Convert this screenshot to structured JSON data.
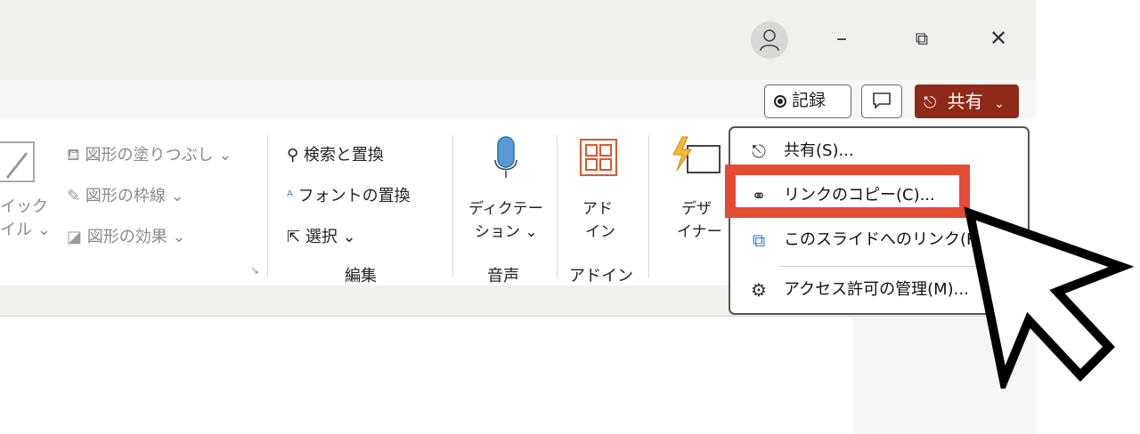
{
  "window": {
    "minimize": "–",
    "restore": "⧉",
    "close": "✕"
  },
  "toolbar": {
    "record_label": "記録",
    "comment_icon": "comment-icon",
    "share_label": "共有",
    "share_chevron": "⌄"
  },
  "ribbon": {
    "left_partial": [
      "イック",
      "イル ⌄"
    ],
    "shape_items": [
      "図形の塗りつぶし ⌄",
      "図形の枠線 ⌄",
      "図形の効果 ⌄"
    ],
    "edit_items": [
      "検索と置換",
      "フォントの置換",
      "選択 ⌄"
    ],
    "edit_group_label": "編集",
    "dictate_label": [
      "ディクテー",
      "ション ⌄"
    ],
    "voice_group_label": "音声",
    "addin_label": [
      "アド",
      "イン"
    ],
    "addin_group_label": "アドイン",
    "designer_label": [
      "デザ",
      "イナー"
    ],
    "colors": {
      "accent_share": "#8e2a17",
      "highlight": "#e34b35",
      "mic": "#5b9bd5",
      "addin": "#e0552b"
    }
  },
  "share_menu": {
    "items": [
      {
        "icon": "share-icon",
        "label": "共有(S)..."
      },
      {
        "icon": "link-icon",
        "label": "リンクのコピー(C)..."
      },
      {
        "icon": "slide-link-icon",
        "label": "このスライドへのリンク(K)"
      },
      {
        "icon": "gear-icon",
        "label": "アクセス許可の管理(M)..."
      }
    ]
  }
}
